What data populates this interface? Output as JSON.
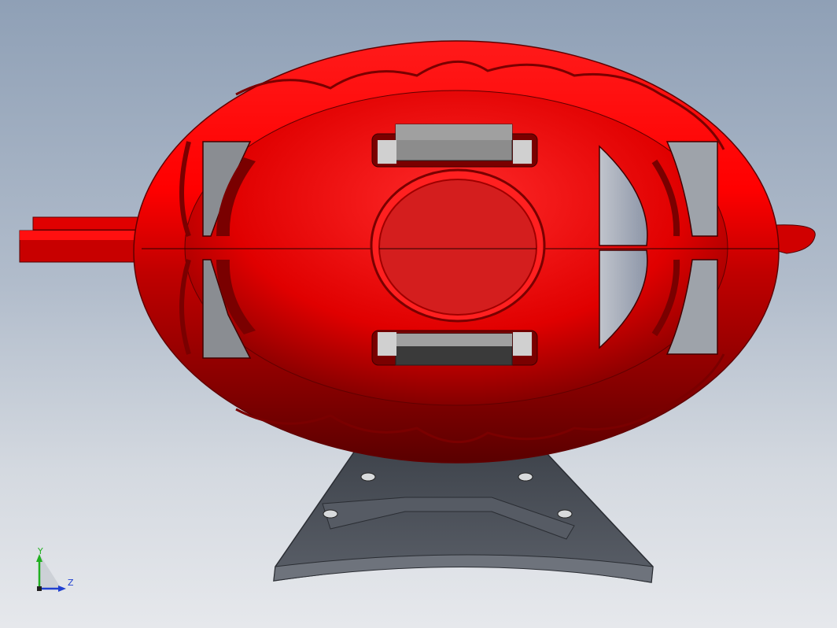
{
  "viewport": {
    "background_top": "#8fa0b6",
    "background_bottom": "#e6e8ec"
  },
  "model": {
    "body_color": "#e00000",
    "body_dark": "#5a0000",
    "stand_color": "#4a4f58",
    "component_color": "#8c8c8c"
  },
  "triad": {
    "y_label": "Y",
    "z_label": "Z",
    "y_color": "#20b020",
    "z_color": "#2040d0"
  }
}
